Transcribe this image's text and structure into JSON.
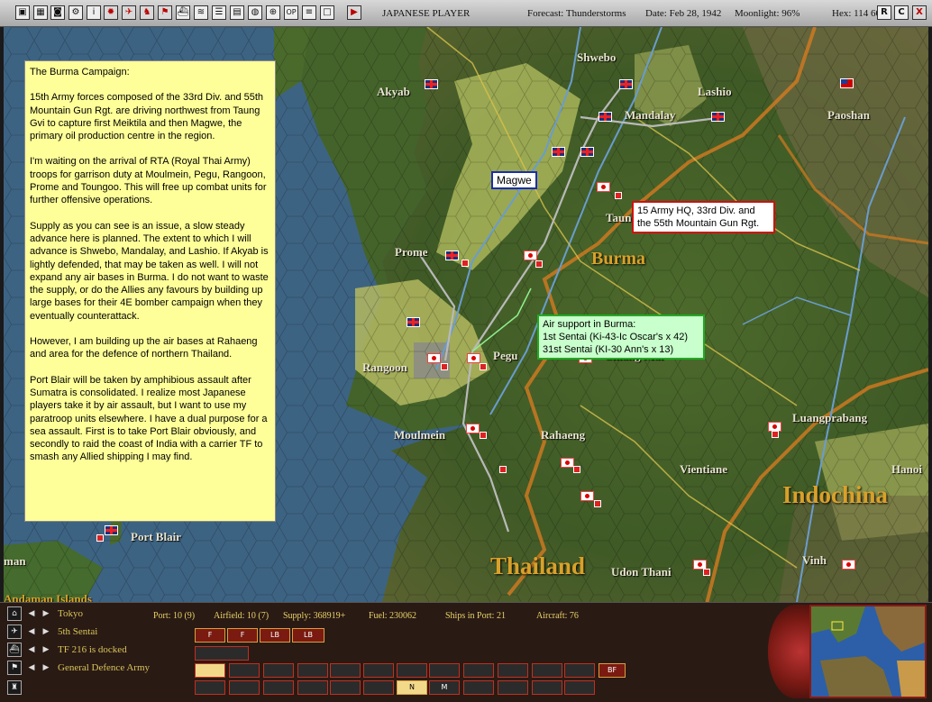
{
  "topbar": {
    "icons": [
      "save-icon",
      "map-icon",
      "camera-icon",
      "settings-icon",
      "info-icon",
      "sun-icon",
      "aircraft-icon",
      "soldier-icon",
      "flag-icon",
      "ship-icon",
      "road-icon",
      "list-icon",
      "base-icon",
      "globe-icon",
      "zoom-icon",
      "op-icon",
      "report-icon",
      "window-icon",
      "play-icon"
    ],
    "player": "JAPANESE PLAYER",
    "forecast": "Forecast: Thunderstorms",
    "date": "Date: Feb 28, 1942",
    "moonlight": "Moonlight: 96%",
    "hex": "Hex: 114 60",
    "right_buttons": [
      "R",
      "C",
      "X"
    ]
  },
  "narrative": {
    "paragraphs": [
      "The Burma Campaign:",
      "15th Army forces composed of the 33rd Div. and 55th Mountain Gun Rgt. are driving northwest from Taung Gvi to capture first Meiktila and then Magwe, the primary oil production centre in the region.",
      "I'm waiting on the arrival of RTA (Royal Thai Army) troops for garrison duty at Moulmein, Pegu, Rangoon, Prome and Toungoo. This will free up combat units for further offensive operations.",
      "Supply as you can see is an issue, a slow steady advance here is planned. The extent to which I will advance is Shwebo, Mandalay, and Lashio. If Akyab is lightly defended, that may be taken as well. I will not expand any air bases in Burma. I do not want to waste the supply, or do the Allies any favours by building up large bases for their 4E bomber campaign when they eventually counterattack.",
      "However, I am building up the air bases at Rahaeng and area for the defence of northern Thailand.",
      "Port Blair will be taken by amphibious assault after Sumatra is consolidated. I realize most Japanese players take it by air assault, but I want to use my paratroop units elsewhere. I have a dual purpose for a sea assault. First is to take Port Blair obviously, and secondly to raid the coast of India with a carrier TF to smash any Allied shipping I may find."
    ]
  },
  "callouts": {
    "magwe": "Magwe",
    "hq": "15 Army HQ, 33rd Div. and the 55th Mountain Gun Rgt.",
    "air_title": "Air support in Burma:",
    "air_line1": "1st Sentai (Ki-43-Ic Oscar's x 42)",
    "air_line2": "31st Sentai (KI-30 Ann's x 13)"
  },
  "map_labels": {
    "cities": [
      "Akyab",
      "Shwebo",
      "Lashio",
      "Mandalay",
      "Paoshan",
      "Taung Gyi",
      "Prome",
      "Rangoon",
      "Pegu",
      "Chiang Mai",
      "Moulmein",
      "Rahaeng",
      "Luangprabang",
      "Vientiane",
      "Hanoi",
      "Port Blair",
      "Udon Thani",
      "Vinh",
      "man",
      "Andaman Islands"
    ],
    "regions": [
      "Burma",
      "Indochina",
      "Thailand"
    ]
  },
  "bottom": {
    "rows": [
      {
        "icon": "base-icon",
        "label": "Tokyo"
      },
      {
        "icon": "aircraft-icon",
        "label": "5th Sentai"
      },
      {
        "icon": "ship-icon",
        "label": "TF 216 is docked"
      },
      {
        "icon": "flag-icon",
        "label": "General Defence Army"
      },
      {
        "icon": "hq-icon",
        "label": ""
      }
    ],
    "port": "Port: 10 (9)",
    "airfield": "Airfield: 10 (7)",
    "supply": "Supply: 368919+",
    "fuel": "Fuel: 230062",
    "ships_in_port": "Ships in Port: 21",
    "aircraft": "Aircraft: 76",
    "row1_buttons": [
      "F",
      "F",
      "LB",
      "LB"
    ],
    "row3_buttons": [
      "",
      "",
      "",
      "",
      "",
      "",
      "",
      "",
      "",
      "",
      "",
      "",
      "BF"
    ],
    "row4_buttons": [
      "",
      "",
      "",
      "",
      "",
      "",
      "",
      "",
      "N",
      "M",
      "",
      "",
      "",
      "",
      ""
    ]
  },
  "colors": {
    "narrative_bg": "#ffff99",
    "hq_border": "#d01010",
    "magwe_border": "#1a2eb0",
    "air_border": "#22aa22",
    "region_text": "#d9a12a"
  }
}
